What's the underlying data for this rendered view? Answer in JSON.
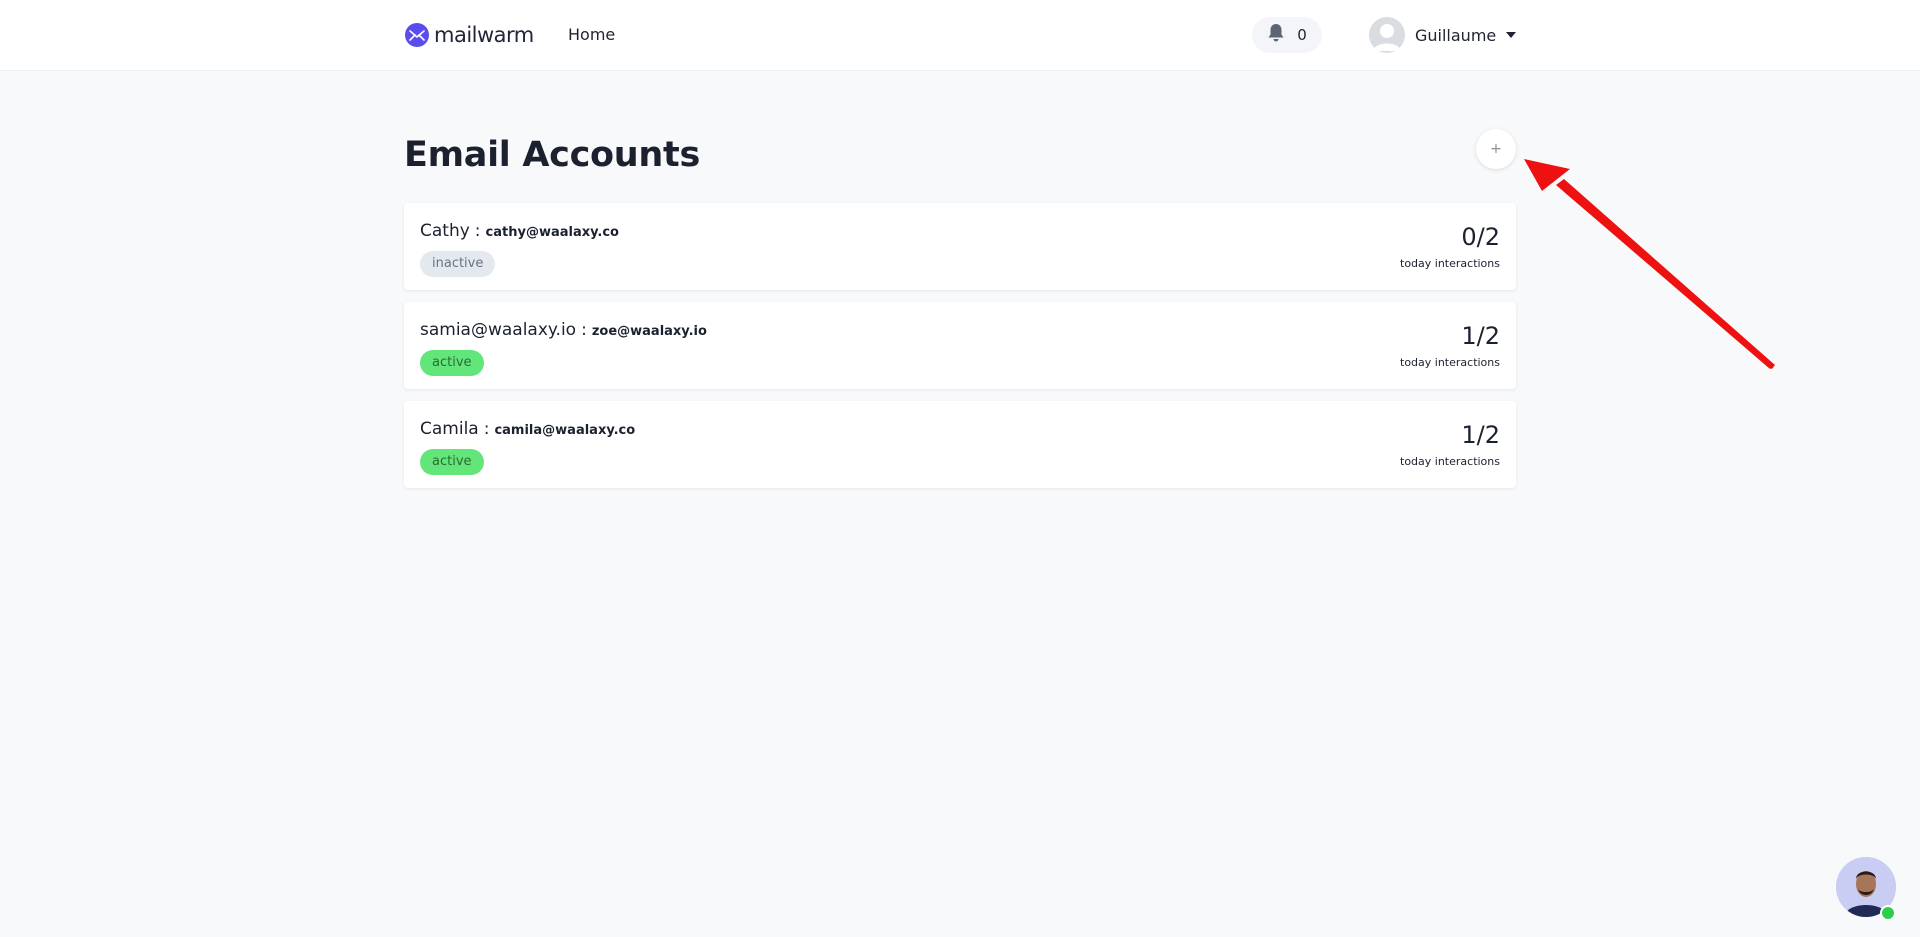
{
  "header": {
    "brand_name": "mailwarm",
    "nav_home": "Home",
    "notifications_count": "0",
    "user_name": "Guillaume"
  },
  "page": {
    "title": "Email Accounts",
    "add_button_label": "+"
  },
  "accounts": [
    {
      "name": "Cathy",
      "separator": ":",
      "email": "cathy@waalaxy.co",
      "status": "inactive",
      "count": "0/2",
      "count_label": "today interactions"
    },
    {
      "name": "samia@waalaxy.io",
      "separator": ":",
      "email": "zoe@waalaxy.io",
      "status": "active",
      "count": "1/2",
      "count_label": "today interactions"
    },
    {
      "name": "Camila",
      "separator": ":",
      "email": "camila@waalaxy.co",
      "status": "active",
      "count": "1/2",
      "count_label": "today interactions"
    }
  ],
  "colors": {
    "brand": "#5b4cf0",
    "active_badge": "#62e67a",
    "inactive_badge": "#e4e8ef",
    "annotation_arrow": "#ee1111",
    "online_status": "#2ccf4c"
  },
  "icons": {
    "brand": "envelope-chart-icon",
    "notifications": "bell-icon",
    "user": "user-avatar-icon",
    "menu": "caret-down-icon",
    "annotation": "red-arrow-icon",
    "chat": "support-agent-avatar"
  }
}
